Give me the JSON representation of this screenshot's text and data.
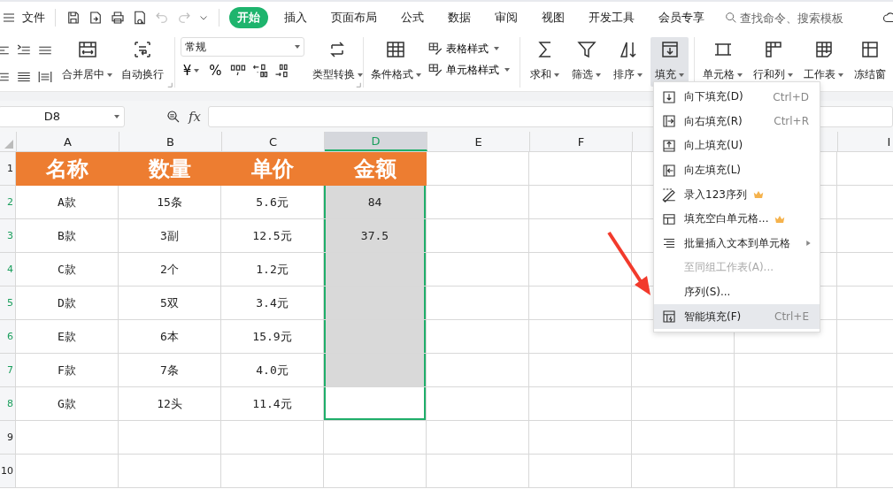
{
  "menu_bar": {
    "file": {
      "label": "文件"
    },
    "tabs": [
      {
        "label": "开始",
        "selected": true
      },
      {
        "label": "插入",
        "selected": false
      },
      {
        "label": "页面布局",
        "selected": false
      },
      {
        "label": "公式",
        "selected": false
      },
      {
        "label": "数据",
        "selected": false
      },
      {
        "label": "审阅",
        "selected": false
      },
      {
        "label": "视图",
        "selected": false
      },
      {
        "label": "开发工具",
        "selected": false
      },
      {
        "label": "会员专享",
        "selected": false
      }
    ],
    "search": {
      "placeholder": "查找命令、搜索模板"
    }
  },
  "toolbar": {
    "merge_buttons": [
      {
        "label": "合并居中",
        "caret": true,
        "selected": false
      },
      {
        "label": "自动换行",
        "caret": false,
        "selected": false
      }
    ],
    "number_format": {
      "value": "常规"
    },
    "currency": {
      "label": "¥",
      "caret": true
    },
    "percent": {
      "label": "%"
    },
    "type_convert": {
      "label": "类型转换",
      "caret": true,
      "selected": false
    },
    "conditional_format": {
      "label": "条件格式",
      "caret": true,
      "selected": false
    },
    "style_buttons": [
      {
        "label": "表格样式",
        "caret": true
      },
      {
        "label": "单元格样式",
        "caret": true
      }
    ],
    "data_buttons": [
      {
        "label": "求和",
        "caret": true,
        "selected": false
      },
      {
        "label": "筛选",
        "caret": true,
        "selected": false
      },
      {
        "label": "排序",
        "caret": true,
        "selected": false
      },
      {
        "label": "填充",
        "caret": true,
        "selected": true
      }
    ],
    "cell_buttons": [
      {
        "label": "单元格",
        "caret": true,
        "selected": false
      },
      {
        "label": "行和列",
        "caret": true,
        "selected": false
      },
      {
        "label": "工作表",
        "caret": true,
        "selected": false
      },
      {
        "label": "冻结窗",
        "caret": false,
        "selected": false
      }
    ]
  },
  "formula_bar": {
    "name_box": {
      "value": "D8"
    },
    "fx_label": "fx"
  },
  "sheet": {
    "columns": [
      {
        "label": "A",
        "selected": false
      },
      {
        "label": "B",
        "selected": false
      },
      {
        "label": "C",
        "selected": false
      },
      {
        "label": "D",
        "selected": true
      },
      {
        "label": "E",
        "selected": false
      },
      {
        "label": "F",
        "selected": false
      },
      {
        "label": "I",
        "selected": false
      }
    ],
    "rows": [
      {
        "number": "1",
        "kind": "header",
        "selected": false,
        "cells": [
          "名称",
          "数量",
          "单价",
          "金额"
        ]
      },
      {
        "number": "2",
        "kind": "data",
        "selected": true,
        "cells": [
          "A款",
          "15条",
          "5.6元",
          "84"
        ]
      },
      {
        "number": "3",
        "kind": "data",
        "selected": true,
        "cells": [
          "B款",
          "3副",
          "12.5元",
          "37.5"
        ]
      },
      {
        "number": "4",
        "kind": "data",
        "selected": true,
        "cells": [
          "C款",
          "2个",
          "1.2元"
        ]
      },
      {
        "number": "5",
        "kind": "data",
        "selected": true,
        "cells": [
          "D款",
          "5双",
          "3.4元"
        ]
      },
      {
        "number": "6",
        "kind": "data",
        "selected": true,
        "cells": [
          "E款",
          "6本",
          "15.9元"
        ]
      },
      {
        "number": "7",
        "kind": "data",
        "selected": true,
        "cells": [
          "F款",
          "7条",
          "4.0元"
        ]
      },
      {
        "number": "8",
        "kind": "data",
        "selected": true,
        "active": true,
        "cells": [
          "G款",
          "12头",
          "11.4元"
        ]
      },
      {
        "number": "9",
        "kind": "empty",
        "selected": false,
        "cells": []
      },
      {
        "number": "10",
        "kind": "empty",
        "selected": false,
        "cells": []
      }
    ]
  },
  "fill_menu": {
    "items": [
      {
        "label": "向下填充(D)",
        "shortcut": "Ctrl+D",
        "kind": "command",
        "disabled": false,
        "premium": false,
        "selected": false
      },
      {
        "label": "向右填充(R)",
        "shortcut": "Ctrl+R",
        "kind": "command",
        "disabled": false,
        "premium": false,
        "selected": false
      },
      {
        "label": "向上填充(U)",
        "kind": "command",
        "disabled": false,
        "premium": false,
        "selected": false
      },
      {
        "label": "向左填充(L)",
        "kind": "command",
        "disabled": false,
        "premium": false,
        "selected": false
      },
      {
        "label": "录入123序列",
        "kind": "command",
        "disabled": false,
        "premium": true,
        "selected": false
      },
      {
        "label": "填充空白单元格...",
        "kind": "command",
        "disabled": false,
        "premium": true,
        "selected": false
      },
      {
        "label": "批量插入文本到单元格",
        "kind": "submenu",
        "disabled": false,
        "premium": false,
        "selected": false
      },
      {
        "label": "至同组工作表(A)...",
        "kind": "command",
        "disabled": true,
        "premium": false,
        "selected": false
      },
      {
        "label": "序列(S)...",
        "kind": "command",
        "disabled": false,
        "premium": false,
        "selected": false
      },
      {
        "label": "智能填充(F)",
        "shortcut": "Ctrl+E",
        "kind": "command",
        "disabled": false,
        "premium": false,
        "selected": true
      }
    ]
  }
}
